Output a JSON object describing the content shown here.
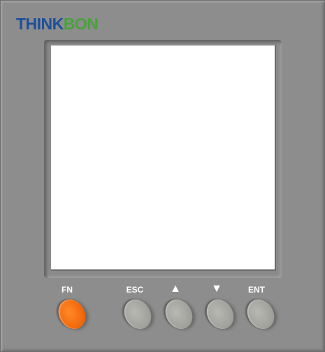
{
  "brand": {
    "part1": "THINK",
    "part2": "BON",
    "colors": {
      "part1": "#1d4f9b",
      "part2": "#49a23a"
    }
  },
  "screen": {
    "content": ""
  },
  "keys": [
    {
      "label": "FN",
      "color": "#f36a0c"
    },
    {
      "label": "ESC",
      "color": "#a3a39e"
    },
    {
      "label": "▲",
      "color": "#a3a39e"
    },
    {
      "label": "▼",
      "color": "#a3a39e"
    },
    {
      "label": "ENT",
      "color": "#a3a39e"
    }
  ],
  "colors": {
    "panel": "#8d8d8d",
    "screen": "#ffffff",
    "key_label": "#ffffff"
  }
}
